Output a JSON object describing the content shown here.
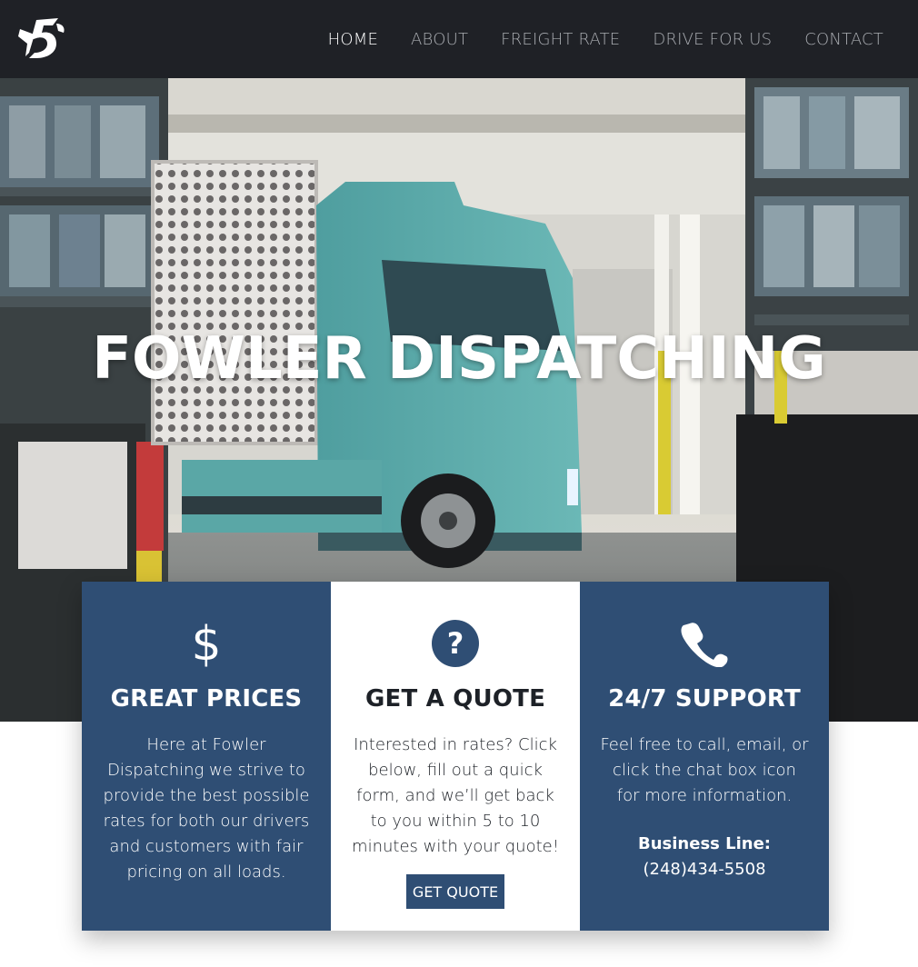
{
  "header": {
    "logo_icon": "fowler-logo-icon",
    "nav": [
      {
        "label": "HOME",
        "active": true
      },
      {
        "label": "ABOUT",
        "active": false
      },
      {
        "label": "FREIGHT RATE",
        "active": false
      },
      {
        "label": "DRIVE FOR US",
        "active": false
      },
      {
        "label": "CONTACT",
        "active": false
      }
    ]
  },
  "hero": {
    "title": "FOWLER DISPATCHING"
  },
  "cards": [
    {
      "icon": "dollar-icon",
      "title": "GREAT PRICES",
      "text": "Here at Fowler Dispatching we strive to provide the best possible rates for both our drivers and customers with fair pricing on all loads."
    },
    {
      "icon": "question-circle-icon",
      "title": "GET A QUOTE",
      "text": "Interested in rates? Click below, fill out a quick form, and we’ll get back to you within 5 to 10 minutes with your quote!",
      "button_label": "GET QUOTE"
    },
    {
      "icon": "phone-icon",
      "title": "24/7 SUPPORT",
      "text": "Feel free to call, email, or click the chat box icon for more information.",
      "business_label": "Business Line:",
      "phone": "(248)434-5508"
    }
  ],
  "colors": {
    "header_bg": "#1f2126",
    "card_blue": "#2f4e74",
    "nav_active": "#ffffff",
    "nav_inactive": "#a9acb1"
  }
}
